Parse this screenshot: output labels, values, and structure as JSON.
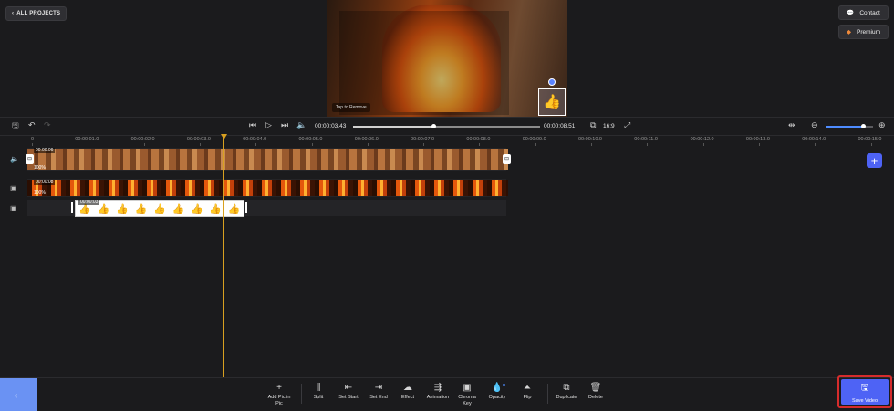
{
  "header": {
    "all_projects": "ALL PROJECTS",
    "contact": "Contact",
    "premium": "Premium"
  },
  "preview": {
    "tap_label": "Tap to Remove",
    "sticker": "👍"
  },
  "controls": {
    "current_time": "00:00:03.43",
    "total_time": "00:00:08.51",
    "aspect_ratio": "16:9",
    "progress": 0.43,
    "zoom_level": 0.8
  },
  "ruler": {
    "labels": [
      "0",
      "00:00:01.0",
      "00:00:02.0",
      "00:00:03.0",
      "00:00:04.0",
      "00:00:05.0",
      "00:00:06.0",
      "00:00:07.0",
      "00:00:08.0",
      "00:00:09.0",
      "00:00:10.0",
      "00:00:11.0",
      "00:00:12.0",
      "00:00:13.0",
      "00:00:14.0",
      "00:00:15.0"
    ]
  },
  "tracks": {
    "main_clip": {
      "duration": "00:00:06",
      "volume": "100%"
    },
    "pip_clip": {
      "duration": "00:00:08",
      "volume": "100%"
    },
    "sticker_clip": {
      "duration": "00:00:03",
      "emoji": "👍"
    }
  },
  "toolbar": {
    "add_pip": "Add Pic in Pic",
    "split": "Split",
    "set_start": "Set Start",
    "set_end": "Set End",
    "effect": "Effect",
    "animation": "Animation",
    "chroma_key": "Chroma Key",
    "opacity": "Opacity",
    "flip": "Flip",
    "duplicate": "Duplicate",
    "delete": "Delete",
    "save_video": "Save Video"
  },
  "colors": {
    "accent": "#4e63f5",
    "back_button": "#6a92f3",
    "playhead": "#d8a020",
    "highlight": "#d62c2c"
  }
}
